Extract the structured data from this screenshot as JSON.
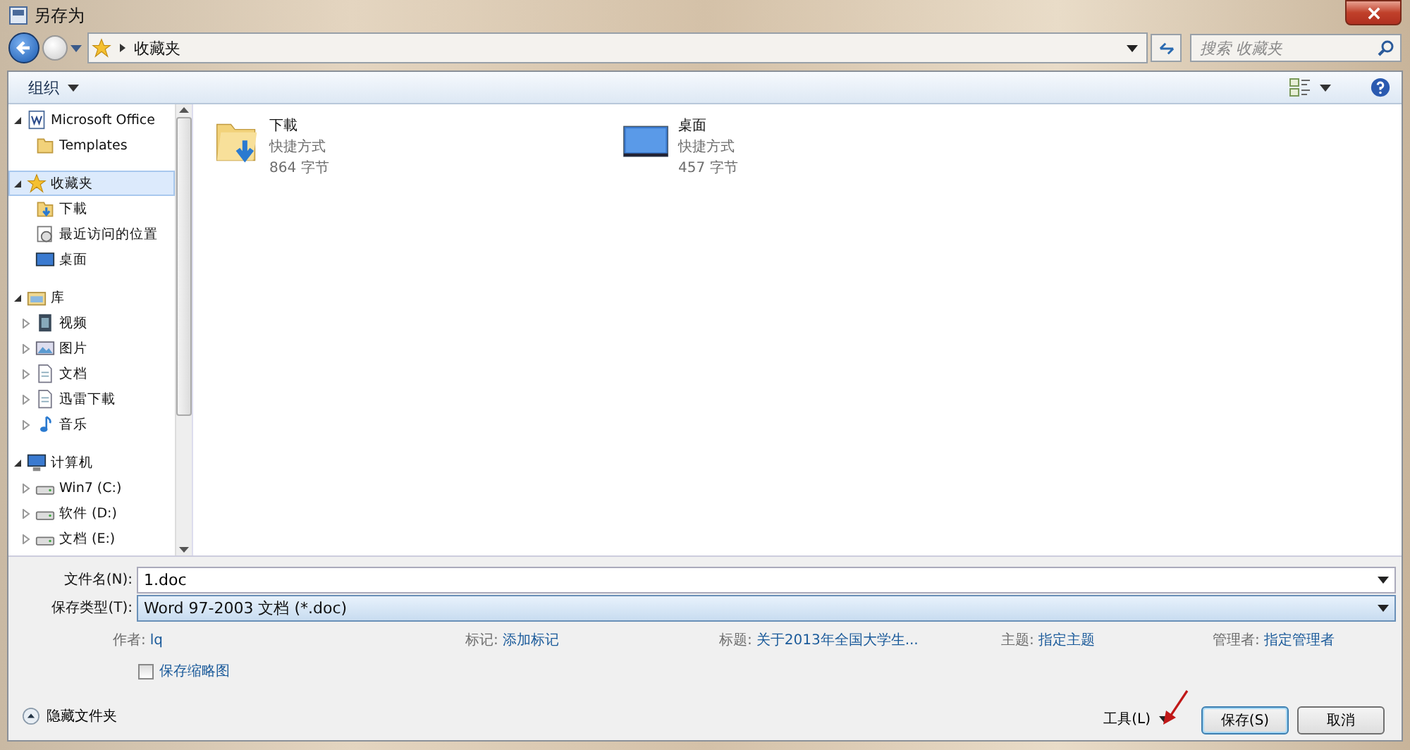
{
  "window": {
    "title": "另存为"
  },
  "address": {
    "path": "收藏夹",
    "search_placeholder": "搜索 收藏夹"
  },
  "toolbar": {
    "organize": "组织"
  },
  "nav": [
    {
      "label": "Microsoft Office",
      "kind": "word",
      "expanded": true,
      "selected": false,
      "children": [
        {
          "label": "Templates",
          "kind": "folder",
          "selected": false
        }
      ]
    },
    {
      "label": "收藏夹",
      "kind": "star",
      "expanded": true,
      "selected": true,
      "children": [
        {
          "label": "下載",
          "kind": "download",
          "selected": false
        },
        {
          "label": "最近访问的位置",
          "kind": "recent",
          "selected": false
        },
        {
          "label": "桌面",
          "kind": "desktop",
          "selected": false
        }
      ]
    },
    {
      "label": "库",
      "kind": "library",
      "expanded": true,
      "selected": false,
      "children": [
        {
          "label": "视频",
          "kind": "video",
          "expanded": false,
          "selected": false
        },
        {
          "label": "图片",
          "kind": "picture",
          "expanded": false,
          "selected": false
        },
        {
          "label": "文档",
          "kind": "document",
          "expanded": false,
          "selected": false
        },
        {
          "label": "迅雷下載",
          "kind": "document",
          "expanded": false,
          "selected": false
        },
        {
          "label": "音乐",
          "kind": "music",
          "expanded": false,
          "selected": false
        }
      ]
    },
    {
      "label": "计算机",
      "kind": "computer",
      "expanded": true,
      "selected": false,
      "children": [
        {
          "label": "Win7 (C:)",
          "kind": "drive",
          "expanded": false,
          "selected": false
        },
        {
          "label": "软件 (D:)",
          "kind": "drive",
          "expanded": false,
          "selected": false
        },
        {
          "label": "文档 (E:)",
          "kind": "drive",
          "expanded": false,
          "selected": false
        }
      ]
    }
  ],
  "files": [
    {
      "name": "下載",
      "kind": "download",
      "type": "快捷方式",
      "size": "864 字节"
    },
    {
      "name": "桌面",
      "kind": "desktop",
      "type": "快捷方式",
      "size": "457 字节"
    }
  ],
  "form": {
    "filename_label": "文件名(N):",
    "filename": "1.doc",
    "type_label": "保存类型(T):",
    "type": "Word 97-2003 文档 (*.doc)"
  },
  "metadata": [
    {
      "label": "作者:",
      "value": "lq"
    },
    {
      "label": "标记:",
      "value": "添加标记"
    },
    {
      "label": "标题:",
      "value": "关于2013年全国大学生..."
    },
    {
      "label": "主题:",
      "value": "指定主题"
    },
    {
      "label": "管理者:",
      "value": "指定管理者"
    }
  ],
  "thumbnail": {
    "label": "保存缩略图",
    "checked": false
  },
  "hide_folders": "隐藏文件夹",
  "buttons": {
    "tools": "工具(L)",
    "save": "保存(S)",
    "cancel": "取消"
  }
}
